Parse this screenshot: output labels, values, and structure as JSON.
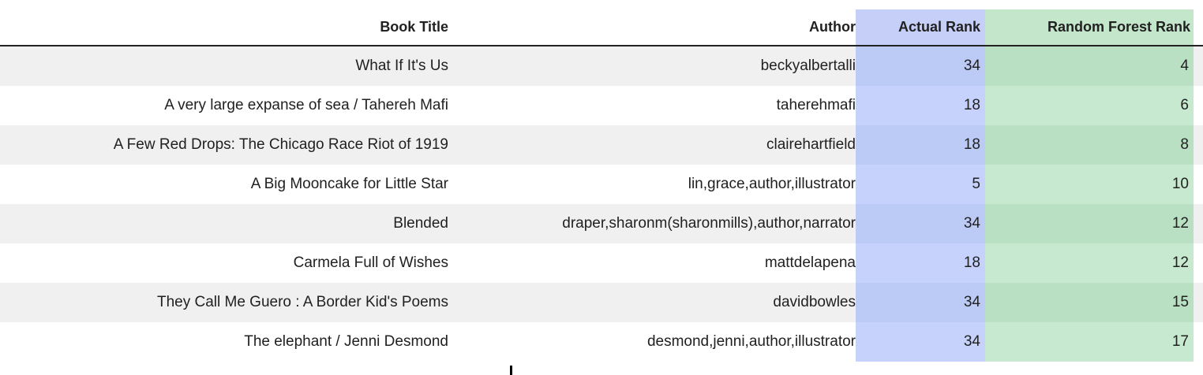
{
  "table": {
    "headers": {
      "book_title": "Book Title",
      "author": "Author",
      "actual_rank": "Actual Rank",
      "random_forest_rank": "Random Forest Rank"
    },
    "rows": [
      {
        "title": "What If It's Us",
        "author": "beckyalbertalli",
        "actual": "34",
        "rf": "4"
      },
      {
        "title": "A very large expanse of sea / Tahereh Mafi",
        "author": "taherehmafi",
        "actual": "18",
        "rf": "6"
      },
      {
        "title": "A Few Red Drops: The Chicago Race Riot of 1919",
        "author": "clairehartfield",
        "actual": "18",
        "rf": "8"
      },
      {
        "title": "A Big Mooncake for Little Star",
        "author": "lin,grace,author,illustrator",
        "actual": "5",
        "rf": "10"
      },
      {
        "title": "Blended",
        "author": "draper,sharonm(sharonmills),author,narrator",
        "actual": "34",
        "rf": "12"
      },
      {
        "title": "Carmela Full of Wishes",
        "author": "mattdelapena",
        "actual": "18",
        "rf": "12"
      },
      {
        "title": "They Call Me Guero : A Border Kid's Poems",
        "author": "davidbowles",
        "actual": "34",
        "rf": "15"
      },
      {
        "title": "The elephant / Jenni Desmond",
        "author": "desmond,jenni,author,illustrator",
        "actual": "34",
        "rf": "17"
      }
    ]
  },
  "colors": {
    "actual_rank_column": "#c5cff8",
    "random_forest_column": "#c4e7cc",
    "striped_row": "#f0f0f0"
  }
}
